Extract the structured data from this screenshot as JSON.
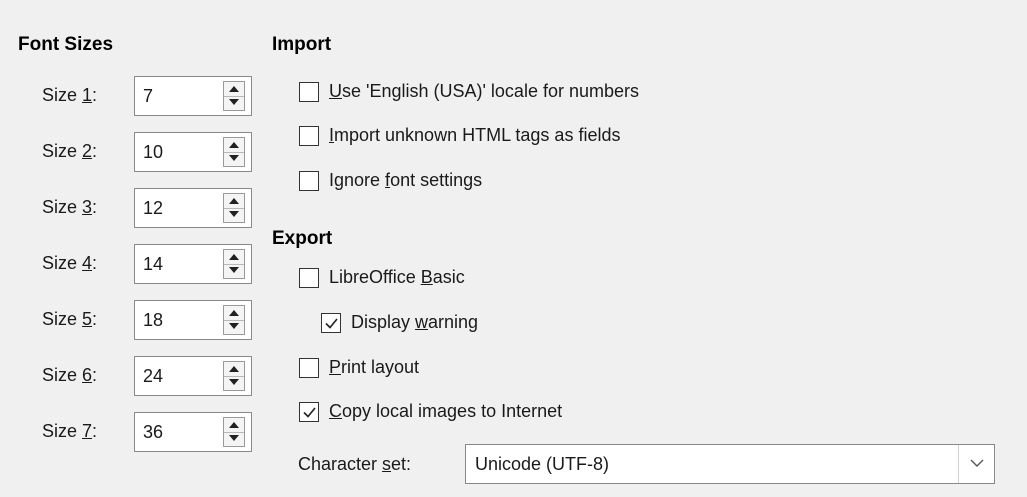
{
  "font_sizes": {
    "title": "Font Sizes",
    "rows": [
      {
        "label_pre": "Size ",
        "mnemonic": "1",
        "label_post": ":",
        "value": "7"
      },
      {
        "label_pre": "Size ",
        "mnemonic": "2",
        "label_post": ":",
        "value": "10"
      },
      {
        "label_pre": "Size ",
        "mnemonic": "3",
        "label_post": ":",
        "value": "12"
      },
      {
        "label_pre": "Size ",
        "mnemonic": "4",
        "label_post": ":",
        "value": "14"
      },
      {
        "label_pre": "Size ",
        "mnemonic": "5",
        "label_post": ":",
        "value": "18"
      },
      {
        "label_pre": "Size ",
        "mnemonic": "6",
        "label_post": ":",
        "value": "24"
      },
      {
        "label_pre": "Size ",
        "mnemonic": "7",
        "label_post": ":",
        "value": "36"
      }
    ]
  },
  "import": {
    "title": "Import",
    "use_english_locale": {
      "pre": "",
      "mnemonic": "U",
      "post": "se 'English (USA)' locale for numbers",
      "checked": false
    },
    "import_unknown_tags": {
      "pre": "",
      "mnemonic": "I",
      "post": "mport unknown HTML tags as fields",
      "checked": false
    },
    "ignore_font_settings": {
      "pre": "Ignore ",
      "mnemonic": "f",
      "post": "ont settings",
      "checked": false
    }
  },
  "export": {
    "title": "Export",
    "libreoffice_basic": {
      "pre": "LibreOffice ",
      "mnemonic": "B",
      "post": "asic",
      "checked": false
    },
    "display_warning": {
      "pre": "Display ",
      "mnemonic": "w",
      "post": "arning",
      "checked": true
    },
    "print_layout": {
      "pre": "",
      "mnemonic": "P",
      "post": "rint layout",
      "checked": false
    },
    "copy_local_images": {
      "pre": "",
      "mnemonic": "C",
      "post": "opy local images to Internet",
      "checked": true
    },
    "character_set": {
      "label_pre": "Character ",
      "mnemonic": "s",
      "label_post": "et:",
      "value": "Unicode (UTF-8)"
    }
  }
}
